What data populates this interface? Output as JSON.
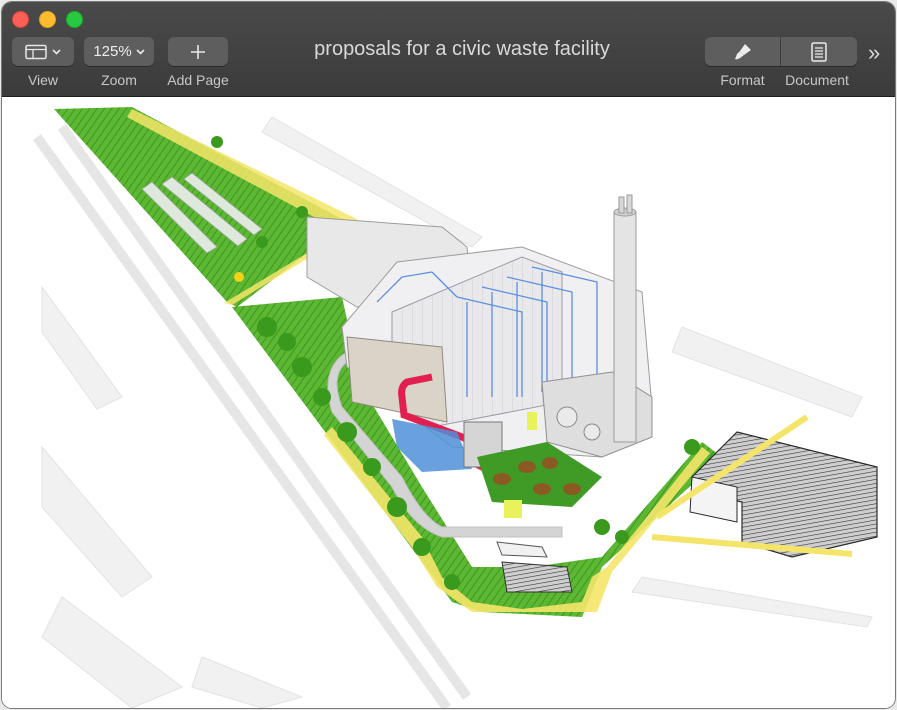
{
  "window": {
    "title": "proposals for a civic waste facility"
  },
  "toolbar": {
    "view": {
      "label": "View",
      "icon": "sidebar-layout-icon"
    },
    "zoom": {
      "label": "Zoom",
      "value": "125%"
    },
    "add_page": {
      "label": "Add Page",
      "icon": "plus-icon"
    },
    "format": {
      "label": "Format",
      "icon": "paintbrush-icon"
    },
    "document": {
      "label": "Document",
      "icon": "document-icon"
    },
    "overflow": "»"
  },
  "colors": {
    "toolbar_bg": "#3f3f3f",
    "grass": "#4fae2c",
    "path_yellow": "#f4e56a",
    "red_pipe": "#e2204f",
    "water_blue": "#4f8fd8"
  }
}
